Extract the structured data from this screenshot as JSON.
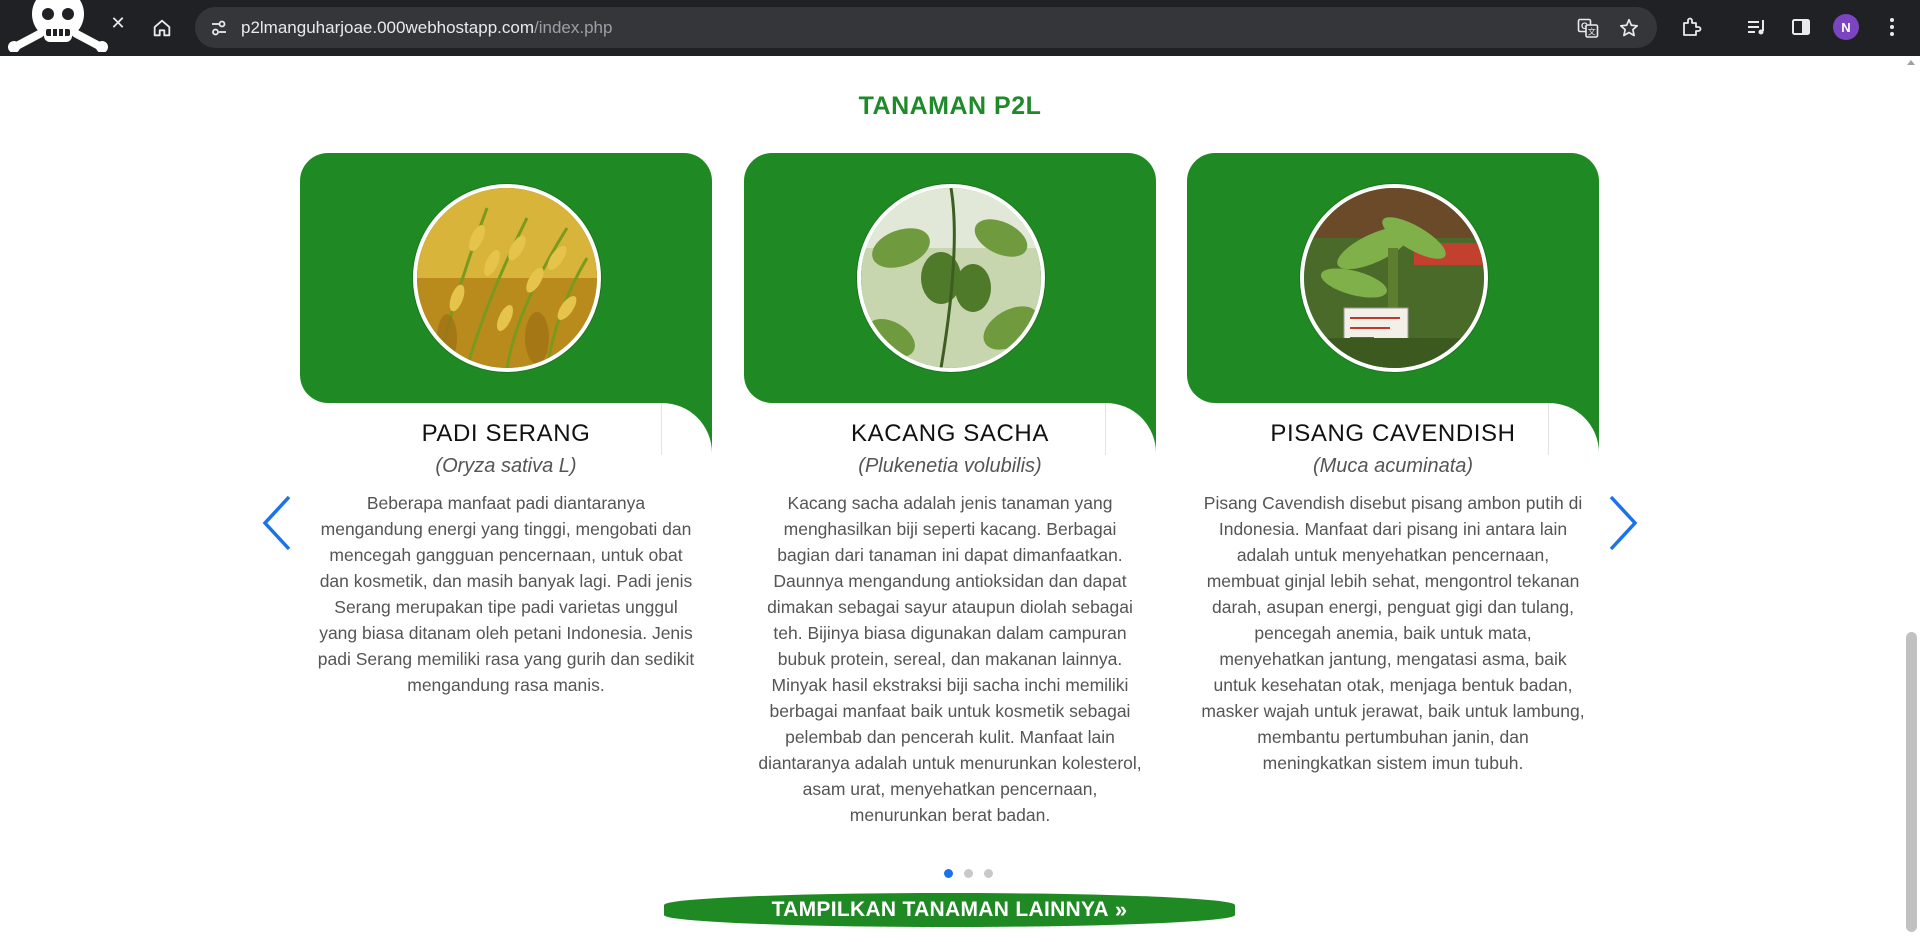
{
  "browser": {
    "url_host": "p2lmanguharjoae.000webhostapp.com",
    "url_path": "/index.php",
    "tab_close": "✕",
    "profile_initial": "N",
    "icons": [
      "pirate-skull-icon",
      "close-icon",
      "home-icon",
      "site-info-icon",
      "translate-icon",
      "star-icon",
      "extensions-icon",
      "media-control-icon",
      "side-panel-icon",
      "avatar",
      "kebab-menu-icon"
    ]
  },
  "section": {
    "title": "TANAMAN P2L"
  },
  "cards": [
    {
      "name": "PADI SERANG",
      "latin": "(Oryza sativa L)",
      "description": "Beberapa manfaat padi diantaranya mengandung energi yang tinggi, mengobati dan mencegah gangguan pencernaan, untuk obat dan kosmetik, dan masih banyak lagi. Padi jenis Serang merupakan tipe padi varietas unggul yang biasa ditanam oleh petani Indonesia. Jenis padi Serang memiliki rasa yang gurih dan sedikit mengandung rasa manis."
    },
    {
      "name": "KACANG SACHA",
      "latin": "(Plukenetia volubilis)",
      "description": "Kacang sacha adalah jenis tanaman yang menghasilkan biji seperti kacang. Berbagai bagian dari tanaman ini dapat dimanfaatkan. Daunnya mengandung antioksidan dan dapat dimakan sebagai sayur ataupun diolah sebagai teh. Bijinya biasa digunakan dalam campuran bubuk protein, sereal, dan makanan lainnya. Minyak hasil ekstraksi biji sacha inchi memiliki berbagai manfaat baik untuk kosmetik sebagai pelembab dan pencerah kulit. Manfaat lain diantaranya adalah untuk menurunkan kolesterol, asam urat, menyehatkan pencernaan, menurunkan berat badan."
    },
    {
      "name": "PISANG CAVENDISH",
      "latin": "(Muca acuminata)",
      "description": "Pisang Cavendish disebut pisang ambon putih di Indonesia. Manfaat dari pisang ini antara lain adalah untuk menyehatkan pencernaan, membuat ginjal lebih sehat, mengontrol tekanan darah, asupan energi, penguat gigi dan tulang, pencegah anemia, baik untuk mata, menyehatkan jantung, mengatasi asma, baik untuk kesehatan otak, menjaga bentuk badan, masker wajah untuk jerawat, baik untuk lambung, membantu pertumbuhan janin, dan meningkatkan sistem imun tubuh."
    }
  ],
  "carousel": {
    "active_dot": 1,
    "dot_count": 3
  },
  "cta": {
    "label": "TAMPILKAN TANAMAN LAINNYA",
    "chevron": "»"
  },
  "colors": {
    "brand_green": "#1f8a23",
    "title_green": "#1f8a2a",
    "arrow_blue": "#1a73e8"
  }
}
